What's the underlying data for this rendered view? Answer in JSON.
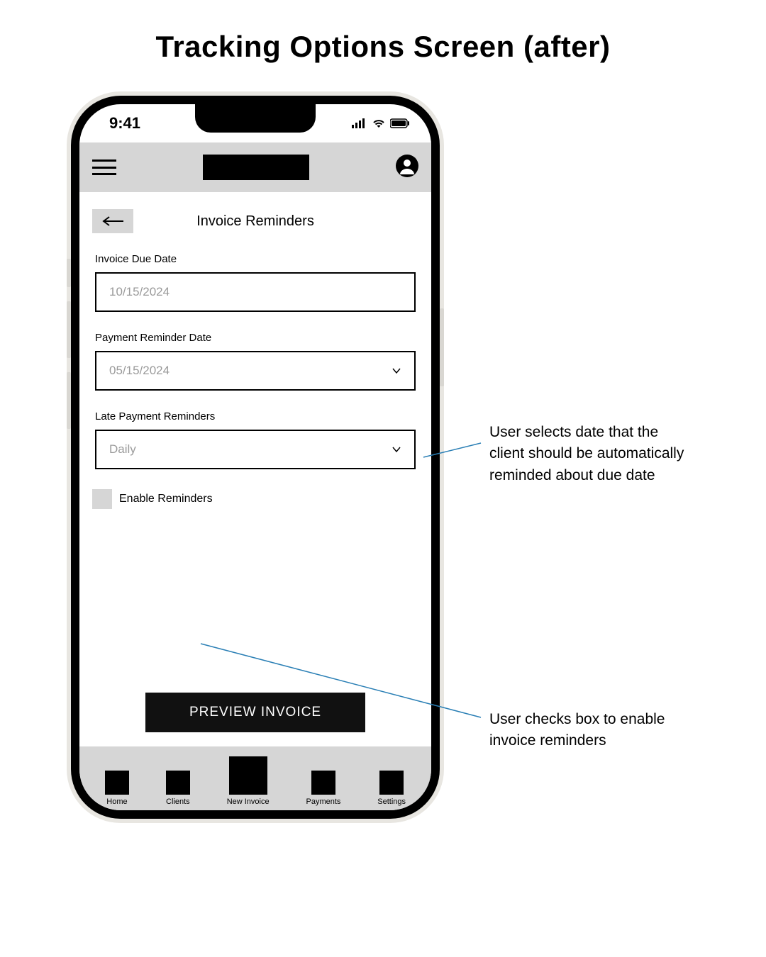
{
  "page_heading": "Tracking Options Screen (after)",
  "status": {
    "time": "9:41"
  },
  "screen": {
    "title": "Invoice Reminders",
    "fields": {
      "invoice_due_date": {
        "label": "Invoice Due Date",
        "value": "10/15/2024"
      },
      "payment_reminder_date": {
        "label": "Payment Reminder Date",
        "value": "05/15/2024"
      },
      "late_payment_reminders": {
        "label": "Late Payment Reminders",
        "value": "Daily"
      },
      "enable_reminders": {
        "label": "Enable Reminders"
      }
    },
    "preview_button": "PREVIEW INVOICE"
  },
  "nav": {
    "items": [
      {
        "label": "Home"
      },
      {
        "label": "Clients"
      },
      {
        "label": "New Invoice"
      },
      {
        "label": "Payments"
      },
      {
        "label": "Settings"
      }
    ]
  },
  "annotations": {
    "a1": "User selects date that the client should be automatically reminded about due date",
    "a2": "User checks box to enable invoice reminders"
  }
}
